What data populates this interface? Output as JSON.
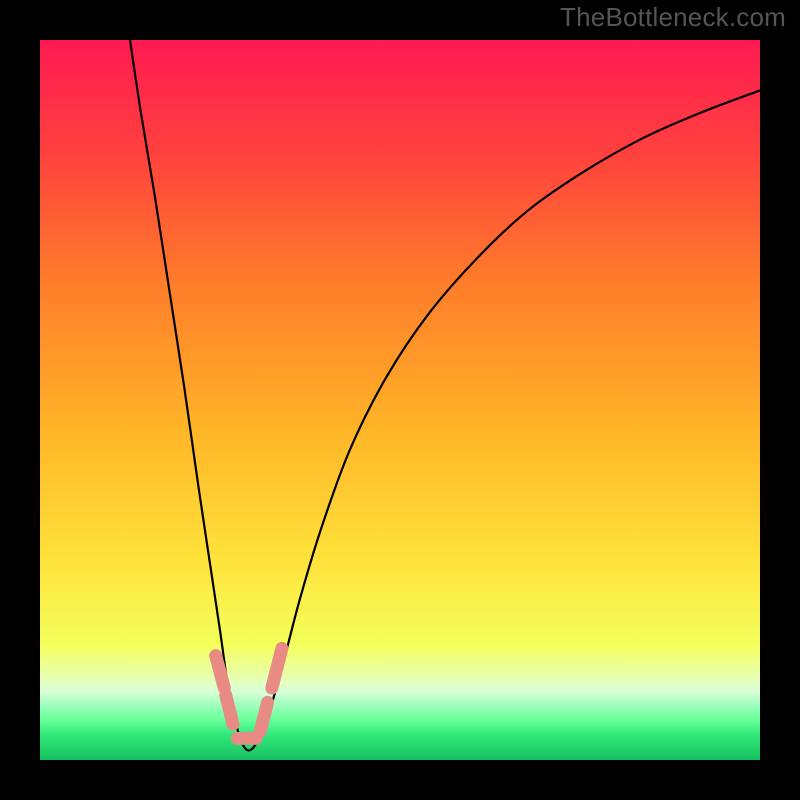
{
  "attribution": "TheBottleneck.com",
  "chart_data": {
    "type": "line",
    "title": "",
    "xlabel": "",
    "ylabel": "",
    "xlim": [
      0,
      100
    ],
    "ylim": [
      0,
      100
    ],
    "grid": false,
    "legend": false,
    "gradient_stops": [
      {
        "offset": 0.0,
        "color": "#ff1a52"
      },
      {
        "offset": 0.15,
        "color": "#ff3f3f"
      },
      {
        "offset": 0.33,
        "color": "#ff7a2a"
      },
      {
        "offset": 0.55,
        "color": "#ffb728"
      },
      {
        "offset": 0.72,
        "color": "#ffe23a"
      },
      {
        "offset": 0.84,
        "color": "#f4ff5c"
      },
      {
        "offset": 0.885,
        "color": "#e8ffb0"
      },
      {
        "offset": 0.905,
        "color": "#d8ffd8"
      },
      {
        "offset": 0.92,
        "color": "#aaffc2"
      },
      {
        "offset": 0.945,
        "color": "#66ff99"
      },
      {
        "offset": 0.965,
        "color": "#30e97a"
      },
      {
        "offset": 1.0,
        "color": "#18c060"
      }
    ],
    "series": [
      {
        "name": "bottleneck-curve",
        "color": "#000000",
        "stroke_width": 2.2,
        "x": [
          12.5,
          14,
          16,
          18,
          20,
          22,
          23.5,
          25,
          26,
          27,
          27.8,
          28.6,
          29.4,
          30.4,
          31.6,
          33.4,
          36,
          39,
          43,
          48,
          54,
          61,
          68,
          76,
          84,
          92,
          100
        ],
        "values": [
          100,
          90,
          78,
          65,
          52,
          38,
          28,
          18,
          11,
          6,
          3,
          1.5,
          1.5,
          3,
          6,
          12,
          22,
          32,
          43,
          53,
          62,
          70,
          76.5,
          82,
          86.5,
          90,
          93
        ]
      }
    ],
    "markers": {
      "name": "trough-marker-segments",
      "color": "#e88b84",
      "stroke_width": 13,
      "linecap": "round",
      "segments": [
        {
          "x1": 24.4,
          "y1": 14.5,
          "x2": 25.6,
          "y2": 10.0
        },
        {
          "x1": 25.8,
          "y1": 9.0,
          "x2": 26.8,
          "y2": 5.0
        },
        {
          "x1": 27.4,
          "y1": 3.0,
          "x2": 30.0,
          "y2": 3.0
        },
        {
          "x1": 30.6,
          "y1": 4.0,
          "x2": 31.6,
          "y2": 8.0
        },
        {
          "x1": 32.2,
          "y1": 10.0,
          "x2": 33.6,
          "y2": 15.5
        }
      ]
    }
  }
}
